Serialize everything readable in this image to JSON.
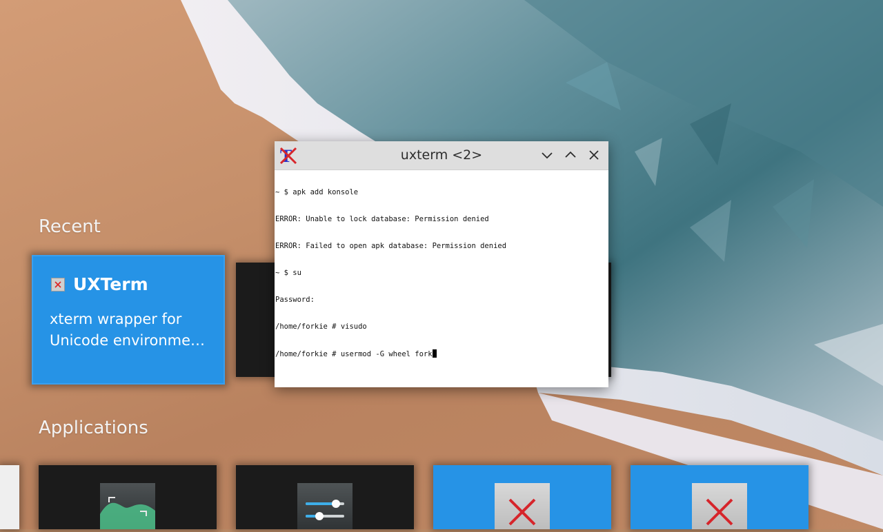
{
  "launcher": {
    "recent_heading": "Recent",
    "applications_heading": "Applications",
    "recent_card": {
      "title": "UXTerm",
      "description": "xterm wrapper for Unicode environme…"
    }
  },
  "window": {
    "title": "uxterm <2>",
    "icon": "xterm-icon",
    "buttons": [
      "minimize-icon",
      "maximize-icon",
      "close-icon"
    ]
  },
  "terminal": {
    "lines": [
      "~ $ apk add konsole",
      "ERROR: Unable to lock database: Permission denied",
      "ERROR: Failed to open apk database: Permission denied",
      "~ $ su",
      "Password:",
      "/home/forkie # visudo"
    ],
    "current_line": "/home/forkie # usermod -G wheel fork"
  },
  "colors": {
    "accent_blue": "#2693e6",
    "card_dark": "#1b1b1b",
    "titlebar": "#dedede"
  }
}
